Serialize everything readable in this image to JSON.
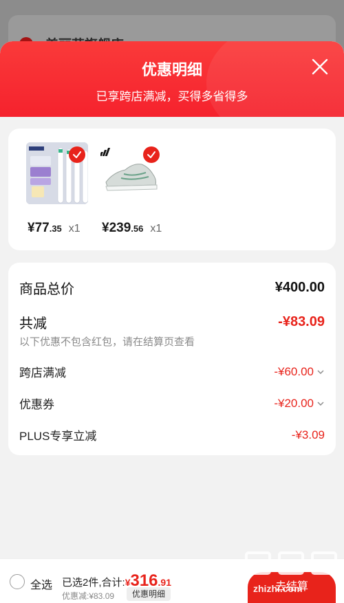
{
  "background": {
    "store_name": "美丽花旗舰店"
  },
  "sheet": {
    "title": "优惠明细",
    "subtitle": "已享跨店满减，买得多省得多"
  },
  "items": [
    {
      "price_symbol": "¥",
      "price_int": "77",
      "price_dec": ".35",
      "qty": "x1"
    },
    {
      "price_symbol": "¥",
      "price_int": "239",
      "price_dec": ".56",
      "qty": "x1"
    }
  ],
  "summary": {
    "total_label": "商品总价",
    "total_value": "¥400.00",
    "reduction_label": "共减",
    "reduction_value": "-¥83.09",
    "note": "以下优惠不包含红包，请在结算页查看",
    "lines": [
      {
        "label": "跨店满减",
        "value": "-¥60.00"
      },
      {
        "label": "优惠券",
        "value": "-¥20.00"
      },
      {
        "label": "PLUS专享立减",
        "value": "-¥3.09"
      }
    ]
  },
  "bottom": {
    "select_all": "全选",
    "selected_text": "已选2件,合计:",
    "total_symbol": "¥",
    "total_int": "316",
    "total_dec": ".91",
    "discount": "优惠减:¥83.09",
    "detail_btn": "优惠明细",
    "checkout": "去结算"
  },
  "watermark": "zhizhi.com",
  "colors": {
    "accent": "#e8231b",
    "header": "#f5222d"
  },
  "icons": [
    "close-icon",
    "check-icon",
    "chevron-down-icon",
    "radio-icon"
  ]
}
